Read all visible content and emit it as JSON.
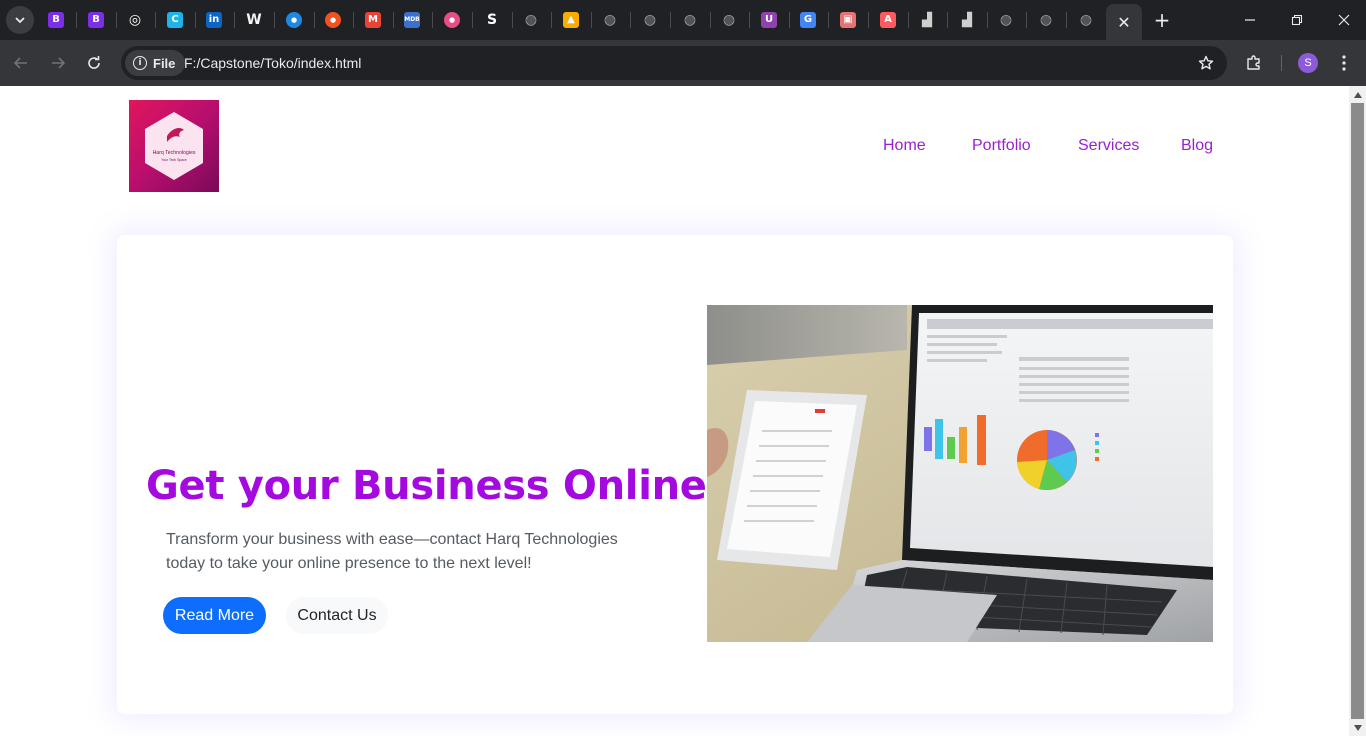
{
  "browser": {
    "tabs": [
      {
        "icon": "bootstrap-icon",
        "glyph": "B",
        "color": "#7c2fe8"
      },
      {
        "icon": "bootstrap-icon",
        "glyph": "B",
        "color": "#7c2fe8"
      },
      {
        "icon": "chatgpt-icon",
        "glyph": "◎",
        "color": "#ffffff"
      },
      {
        "icon": "canva-icon",
        "glyph": "C",
        "color": "#1fb4e8"
      },
      {
        "icon": "linkedin-icon",
        "glyph": "in",
        "color": "#0a66c2"
      },
      {
        "icon": "wikipedia-icon",
        "glyph": "W",
        "color": "#f5f5f5"
      },
      {
        "icon": "globe-blue-icon",
        "glyph": "●",
        "color": "#1e88e5"
      },
      {
        "icon": "fire-icon",
        "glyph": "●",
        "color": "#f4511e"
      },
      {
        "icon": "gmail-icon",
        "glyph": "M",
        "color": "#ea4335"
      },
      {
        "icon": "mdb-icon",
        "glyph": "MDB",
        "color": "#3b71ca"
      },
      {
        "icon": "dribbble-icon",
        "glyph": "●",
        "color": "#ea4c89"
      },
      {
        "icon": "link-icon",
        "glyph": "S",
        "color": "#ffffff"
      },
      {
        "icon": "globe-icon",
        "glyph": "◍",
        "color": "#9aa0a6"
      },
      {
        "icon": "bookmark-icon",
        "glyph": "▲",
        "color": "#f9ab00"
      },
      {
        "icon": "globe-icon",
        "glyph": "◍",
        "color": "#9aa0a6"
      },
      {
        "icon": "globe-icon",
        "glyph": "◍",
        "color": "#9aa0a6"
      },
      {
        "icon": "globe-icon",
        "glyph": "◍",
        "color": "#9aa0a6"
      },
      {
        "icon": "globe-icon",
        "glyph": "◍",
        "color": "#9aa0a6"
      },
      {
        "icon": "upwork-icon",
        "glyph": "U",
        "color": "#8e44ad"
      },
      {
        "icon": "google-icon",
        "glyph": "G",
        "color": "#4285f4"
      },
      {
        "icon": "image-icon",
        "glyph": "▣",
        "color": "#e57373"
      },
      {
        "icon": "airbnb-icon",
        "glyph": "A",
        "color": "#ff5a5f"
      },
      {
        "icon": "figure-icon",
        "glyph": "▟",
        "color": "#111111"
      },
      {
        "icon": "figure-icon",
        "glyph": "▟",
        "color": "#111111"
      },
      {
        "icon": "globe-icon",
        "glyph": "◍",
        "color": "#9aa0a6"
      },
      {
        "icon": "globe-icon",
        "glyph": "◍",
        "color": "#9aa0a6"
      },
      {
        "icon": "globe-icon",
        "glyph": "◍",
        "color": "#9aa0a6"
      }
    ],
    "active_tab_close": "✕",
    "new_tab": "+",
    "site_chip": "File",
    "url": "F:/Capstone/Toko/index.html",
    "profile_initial": "S"
  },
  "site": {
    "logo_text": "Harq Technologies",
    "logo_tagline": "Your Tech Space",
    "nav": [
      "Home",
      "Portfolio",
      "Services",
      "Blog"
    ],
    "nav_color": "#9b1fd1",
    "hero": {
      "title": "Get your Business Online",
      "description": "Transform your business with ease—contact Harq Technologies today to take your online presence to the next level!",
      "primary_button": "Read More",
      "secondary_button": "Contact Us",
      "title_color": "#a40ae0",
      "primary_color": "#0d6efd"
    }
  }
}
